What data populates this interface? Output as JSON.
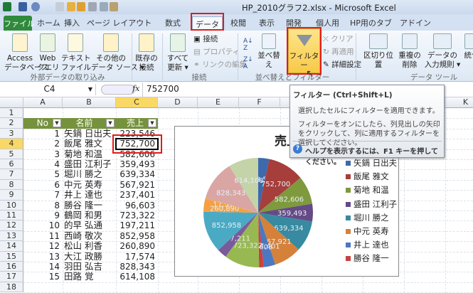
{
  "window": {
    "title": "HP_2010グラフ2.xlsx - Microsoft Excel"
  },
  "tabs": [
    {
      "label": "ファイル"
    },
    {
      "label": "ホーム"
    },
    {
      "label": "挿入"
    },
    {
      "label": "ページ レイアウト"
    },
    {
      "label": "数式"
    },
    {
      "label": "データ"
    },
    {
      "label": "校閲"
    },
    {
      "label": "表示"
    },
    {
      "label": "開発"
    },
    {
      "label": "個人用"
    },
    {
      "label": "HP用のタブ"
    },
    {
      "label": "アドイン"
    }
  ],
  "ribbon": {
    "external": {
      "access": "Access\nデータベース",
      "web": "Web\nクエリ",
      "text": "テキスト\nファイル",
      "other": "その他の\nデータ ソース ▾",
      "group": "外部データの取り込み"
    },
    "existing": "既存の\n接続",
    "connections": {
      "refresh": "すべて\n更新 ▾",
      "conn": "接続",
      "props": "プロパティ",
      "links": "リンクの編集",
      "group": "接続"
    },
    "sort": {
      "sort": "並べ替え",
      "filter": "フィルター",
      "clear": "クリア",
      "reapply": "再適用",
      "advanced": "詳細設定",
      "group": "並べ替えとフィルター"
    },
    "tools": {
      "split": "区切り位置",
      "dup": "重複の\n削除",
      "valid": "データの\n入力規則 ▾",
      "consolidate": "統合",
      "group": "データ ツール"
    }
  },
  "formula": {
    "name_box": "C4",
    "fx": "fx",
    "value": "752700"
  },
  "columns": [
    "A",
    "B",
    "C",
    "D",
    "E",
    "F",
    "G",
    "H",
    "I",
    "J",
    "K"
  ],
  "rows": [
    "1",
    "2",
    "3",
    "4",
    "5",
    "6",
    "7",
    "8",
    "9",
    "10",
    "11",
    "12",
    "13",
    "14",
    "15",
    "16",
    "17",
    "18"
  ],
  "table": {
    "headers": [
      "No",
      "名前",
      "売上"
    ],
    "data": [
      [
        "1",
        "矢鍋 日出夫",
        "223,546"
      ],
      [
        "2",
        "飯尾 雅文",
        "752,700"
      ],
      [
        "3",
        "菊地 和温",
        "582,606"
      ],
      [
        "4",
        "盛田 江利子",
        "359,493"
      ],
      [
        "5",
        "堀川 勝之",
        "639,334"
      ],
      [
        "6",
        "中元 英寿",
        "567,921"
      ],
      [
        "7",
        "井上 達也",
        "237,401"
      ],
      [
        "8",
        "勝谷 隆一",
        "96,603"
      ],
      [
        "9",
        "鶴岡 和男",
        "723,322"
      ],
      [
        "10",
        "的早 弘通",
        "197,211"
      ],
      [
        "11",
        "西崎 敬次",
        "852,958"
      ],
      [
        "12",
        "松山 利香",
        "260,890"
      ],
      [
        "13",
        "大江 政勝",
        "17,574"
      ],
      [
        "14",
        "羽田 弘吉",
        "828,343"
      ],
      [
        "15",
        "田路 覚",
        "614,108"
      ]
    ]
  },
  "tooltip": {
    "title": "フィルター (Ctrl+Shift+L)",
    "line1": "選択したセルにフィルターを適用できます。",
    "line2": "フィルターをオンにしたら、列見出しの矢印をクリックして、列に適用するフィルターを選択してください。",
    "help": "ヘルプを表示するには、F1 キーを押してください。"
  },
  "chart_data": {
    "type": "pie",
    "title": "売上",
    "categories": [
      "矢鍋 日出夫",
      "飯尾 雅文",
      "菊地 和温",
      "盛田 江利子",
      "堀川 勝之",
      "中元 英寿",
      "井上 達也",
      "勝谷 隆一",
      "鶴岡 和男",
      "的早 弘通",
      "西崎 敬次",
      "松山 利香",
      "大江 政勝",
      "羽田 弘吉",
      "田路 覚"
    ],
    "values": [
      223546,
      752700,
      582606,
      359493,
      639334,
      567921,
      237401,
      96603,
      723322,
      197211,
      852958,
      260890,
      17574,
      828343,
      614108
    ],
    "labels": [
      "223,546",
      "752,700",
      "582,606",
      "359,493",
      "639,334",
      "567,921",
      "237,401",
      "96,603",
      "723,322",
      "197,211",
      "852,958",
      "260,890",
      "17,574",
      "828,343",
      "614,108"
    ],
    "colors": [
      "#3d69ad",
      "#a63e3c",
      "#7e9a3d",
      "#654a86",
      "#378aa0",
      "#d5813a",
      "#4a78c2",
      "#c74240",
      "#98b852",
      "#7a5a9a",
      "#4aaac4",
      "#f4a040",
      "#f4a040",
      "#d9a6a4",
      "#c4d4a8"
    ],
    "legend_visible": 8,
    "legend": "right"
  }
}
